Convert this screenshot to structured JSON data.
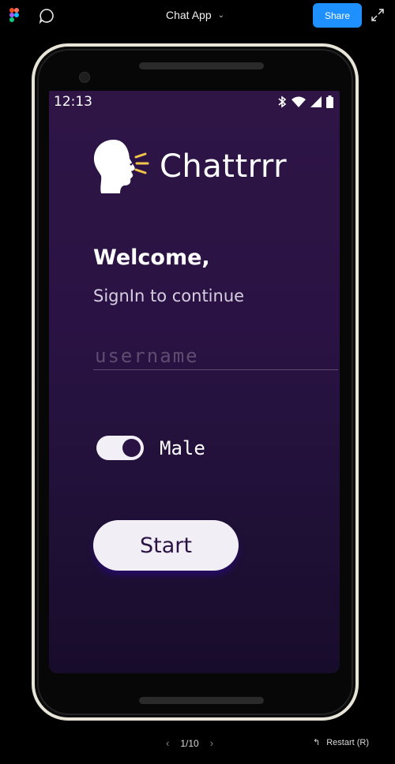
{
  "toolbar": {
    "title": "Chat App",
    "share_label": "Share",
    "icons": [
      "figma-logo-icon",
      "chat-bubble-icon",
      "chevron-down-icon",
      "expand-icon"
    ],
    "share_color": "#1e90ff"
  },
  "device": {
    "status_time": "12:13",
    "status_icons": [
      "bluetooth-icon",
      "wifi-icon",
      "signal-icon",
      "battery-icon"
    ]
  },
  "app": {
    "brand_name": "Chattrrr",
    "welcome": "Welcome,",
    "subtitle": "SignIn to continue",
    "username_placeholder": "username",
    "username_value": "",
    "gender_label": "Male",
    "gender_toggle_on": true,
    "start_label": "Start",
    "background_color": "#2a1344",
    "button_color": "#f1eef6"
  },
  "footer": {
    "page_indicator": "1/10",
    "restart_label": "Restart (R)"
  }
}
